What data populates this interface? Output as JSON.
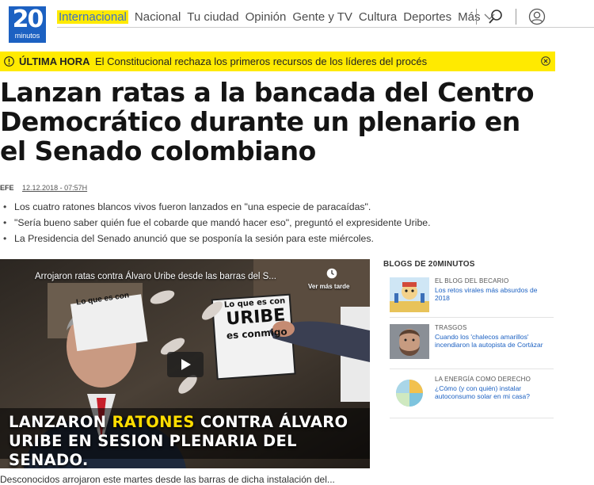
{
  "header": {
    "logo_number": "20",
    "logo_text": "minutos",
    "nav": [
      {
        "label": "Internacional",
        "active": true
      },
      {
        "label": "Nacional"
      },
      {
        "label": "Tu ciudad"
      },
      {
        "label": "Opinión"
      },
      {
        "label": "Gente y TV"
      },
      {
        "label": "Cultura"
      },
      {
        "label": "Deportes"
      }
    ],
    "more_label": "Más"
  },
  "breaking": {
    "label": "ÚLTIMA HORA",
    "message": "El Constitucional rechaza los primeros recursos de los líderes del procés"
  },
  "article": {
    "title": "Lanzan ratas a la bancada del Centro Democrático durante un plenario en el Senado colombiano",
    "source": "EFE",
    "date": "12.12.2018 - 07:57H",
    "bullets": [
      "Los cuatro ratones blancos vivos fueron lanzados en \"una especie de paracaídas\".",
      "\"Sería bueno saber quién fue el cobarde que mandó hacer eso\", preguntó el expresidente Uribe.",
      "La Presidencia del Senado anunció que se posponía la sesión para este miércoles."
    ],
    "bottom_text": "Desconocidos arrojaron este martes desde las barras de dicha instalación del..."
  },
  "video": {
    "title": "Arrojaron ratas contra Álvaro Uribe desde las barras del S...",
    "watch_later": "Ver más tarde",
    "caption_line1_a": "LANZARON ",
    "caption_line1_hl": "RATONES",
    "caption_line1_b": " CONTRA ÁLVARO",
    "caption_line2": "URIBE EN SESION PLENARIA DEL SENADO.",
    "sign1_l1": "Lo que es con",
    "sign1_l2": "URIBE",
    "sign1_l3": "es conmigo",
    "sign2": "Lo que es con"
  },
  "blogs": {
    "heading": "BLOGS DE 20MINUTOS",
    "items": [
      {
        "name": "EL BLOG DEL BECARIO",
        "text": "Los retos virales más absurdos de 2018"
      },
      {
        "name": "TRASGOS",
        "text": "Cuando los 'chalecos amarillos' incendiaron la autopista de Cortázar"
      },
      {
        "name": "LA ENERGÍA COMO DERECHO",
        "text": "¿Cómo (y con quién) instalar autoconsumo solar en mi casa?"
      }
    ]
  },
  "colors": {
    "brand_blue": "#1c61c2",
    "highlight_yellow": "#ffea00"
  }
}
